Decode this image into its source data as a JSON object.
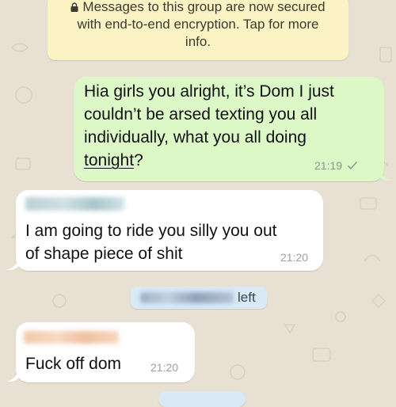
{
  "encryption_notice": {
    "line1": "Messages to this group are now secured",
    "line2": "with end-to-end encryption. Tap for more",
    "line3": "info.",
    "icon": "lock-icon"
  },
  "messages": [
    {
      "direction": "outgoing",
      "lines": [
        "Hia girls you alright, it’s Dom I just",
        "couldn’t be arsed texting you all",
        "individually, what you all doing"
      ],
      "last_line_link": "tonight",
      "last_line_rest": "?",
      "time": "21:19",
      "status_icon": "check-icon"
    },
    {
      "direction": "incoming",
      "lines": [
        "I am going to ride you silly you out",
        "of shape piece of shit"
      ],
      "time": "21:20"
    },
    {
      "direction": "system",
      "text": "left"
    },
    {
      "direction": "incoming",
      "lines": [
        "Fuck off dom"
      ],
      "time": "21:20"
    }
  ],
  "colors": {
    "wallpaper": "#e8e0d2",
    "outgoing_bubble": "#dcf8c6",
    "incoming_bubble": "#ffffff",
    "notice_bubble": "#fbf3c3",
    "system_bubble": "#d9eaf6"
  }
}
